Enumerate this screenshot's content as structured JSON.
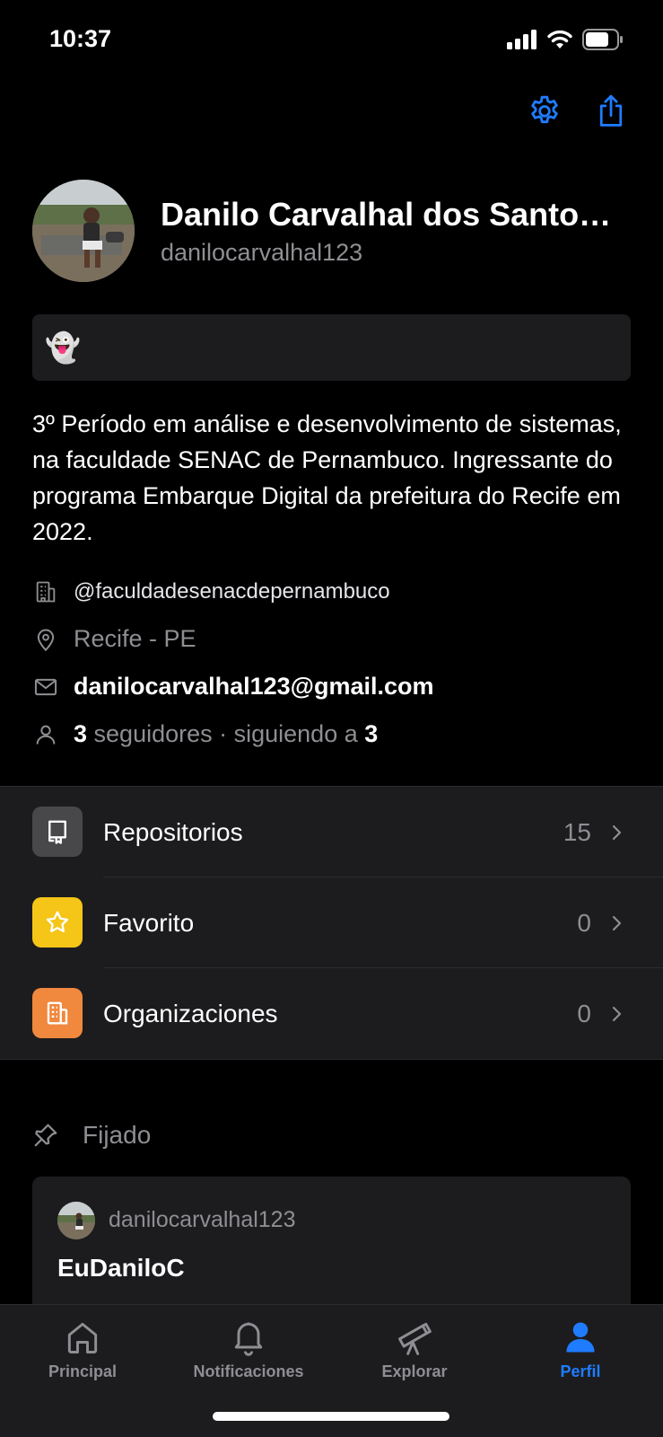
{
  "status_bar": {
    "time": "10:37"
  },
  "profile": {
    "name": "Danilo Carvalhal dos Santo…",
    "username": "danilocarvalhal123",
    "status_emoji": "👻",
    "bio": "3º Período em análise e desenvolvimento de sistemas, na faculdade SENAC de Pernambuco. Ingressante do programa Embarque Digital da prefeitura do Recife em 2022.",
    "company": "@faculdadesenacdepernambuco",
    "location": "Recife - PE",
    "email": "danilocarvalhal123@gmail.com",
    "followers_count": "3",
    "followers_label": " seguidores · siguiendo a ",
    "following_count": "3"
  },
  "menu": {
    "items": [
      {
        "label": "Repositorios",
        "count": "15",
        "icon": "repo-icon",
        "color": "#48484a"
      },
      {
        "label": "Favorito",
        "count": "0",
        "icon": "star-icon",
        "color": "#f5c518"
      },
      {
        "label": "Organizaciones",
        "count": "0",
        "icon": "organization-icon",
        "color": "#f0883e"
      }
    ]
  },
  "pinned": {
    "heading": "Fijado",
    "card": {
      "owner": "danilocarvalhal123",
      "repo": "EuDaniloC"
    }
  },
  "tabbar": {
    "tabs": [
      {
        "label": "Principal",
        "icon": "home-icon"
      },
      {
        "label": "Notificaciones",
        "icon": "bell-icon"
      },
      {
        "label": "Explorar",
        "icon": "telescope-icon"
      },
      {
        "label": "Perfil",
        "icon": "person-icon"
      }
    ],
    "active_color": "#1f7cff"
  }
}
